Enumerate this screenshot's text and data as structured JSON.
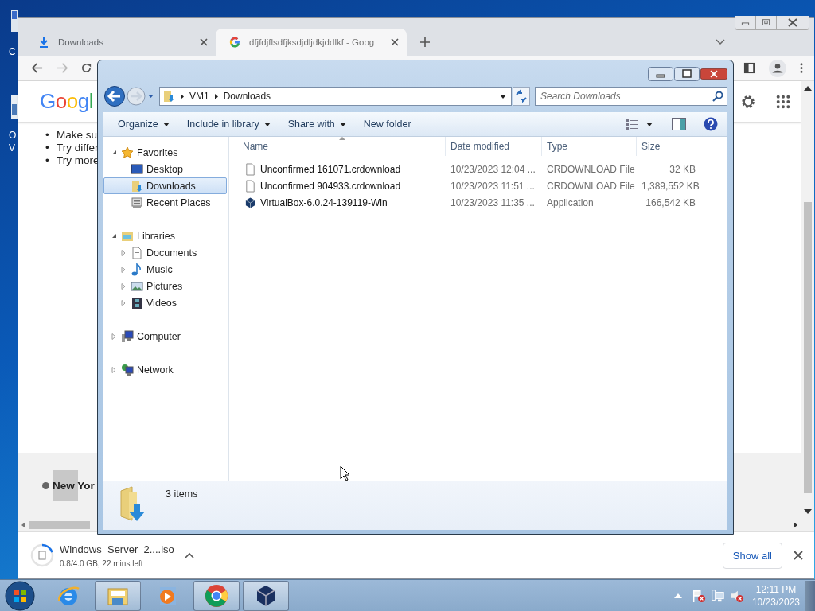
{
  "desktop": {
    "icon_labels": [
      "C",
      "O",
      "V"
    ]
  },
  "browser": {
    "tabs": [
      {
        "label": "Downloads",
        "kind": "downloads",
        "selected": false
      },
      {
        "label": "dfjfdjflsdfjksdjdljdkjddlkf - Goog",
        "kind": "google",
        "selected": true
      }
    ],
    "forward_disabled": true,
    "page": {
      "logo": "Googl",
      "marker": "•",
      "bullets": [
        "Make su",
        "Try differ",
        "Try more"
      ],
      "location": "New Yor"
    },
    "download": {
      "file": "Windows_Server_2....iso",
      "status": "0.8/4.0 GB, 22 mins left",
      "level": 0.2
    },
    "show_all": "Show all"
  },
  "explorer": {
    "forward_disabled": true,
    "path": [
      "VM1",
      "Downloads"
    ],
    "search": {
      "placeholder": "Search Downloads"
    },
    "commands": [
      {
        "label": "Organize",
        "menu": true
      },
      {
        "label": "Include in library",
        "menu": true
      },
      {
        "label": "Share with",
        "menu": true
      },
      {
        "label": "New folder",
        "menu": false
      }
    ],
    "nav": [
      {
        "label": "Favorites",
        "kind": "star",
        "expanded": true,
        "selected": false,
        "children": [
          {
            "label": "Desktop",
            "kind": "desktop",
            "selected": false
          },
          {
            "label": "Downloads",
            "kind": "downloads",
            "selected": true
          },
          {
            "label": "Recent Places",
            "kind": "recent",
            "selected": false
          }
        ]
      },
      {
        "label": "Libraries",
        "kind": "library",
        "expanded": true,
        "selected": false,
        "children": [
          {
            "label": "Documents",
            "kind": "document",
            "expanded": false,
            "selected": false
          },
          {
            "label": "Music",
            "kind": "music",
            "expanded": false,
            "selected": false
          },
          {
            "label": "Pictures",
            "kind": "pictures",
            "expanded": false,
            "selected": false
          },
          {
            "label": "Videos",
            "kind": "videos",
            "expanded": false,
            "selected": false
          }
        ]
      },
      {
        "label": "Computer",
        "kind": "computer",
        "expanded": false,
        "selected": false
      },
      {
        "label": "Network",
        "kind": "network",
        "expanded": false,
        "selected": false
      }
    ],
    "columns": [
      "Name",
      "Date modified",
      "Type",
      "Size"
    ],
    "files": [
      {
        "name": "Unconfirmed 161071.crdownload",
        "date": "10/23/2023 12:04 ...",
        "type": "CRDOWNLOAD File",
        "size": "32 KB",
        "kind": "blank"
      },
      {
        "name": "Unconfirmed 904933.crdownload",
        "date": "10/23/2023 11:51 ...",
        "type": "CRDOWNLOAD File",
        "size": "1,389,552 KB",
        "kind": "blank"
      },
      {
        "name": "VirtualBox-6.0.24-139119-Win",
        "date": "10/23/2023 11:35 ...",
        "type": "Application",
        "size": "166,542 KB",
        "kind": "app"
      }
    ],
    "status": "3 items"
  },
  "taskbar": {
    "apps": [
      {
        "kind": "ie",
        "active": false
      },
      {
        "kind": "explorer",
        "active": true
      },
      {
        "kind": "media",
        "active": false
      },
      {
        "kind": "chrome",
        "active": true
      },
      {
        "kind": "virtualbox",
        "active": true
      }
    ],
    "time": "12:11 PM",
    "date": "10/23/2023"
  }
}
